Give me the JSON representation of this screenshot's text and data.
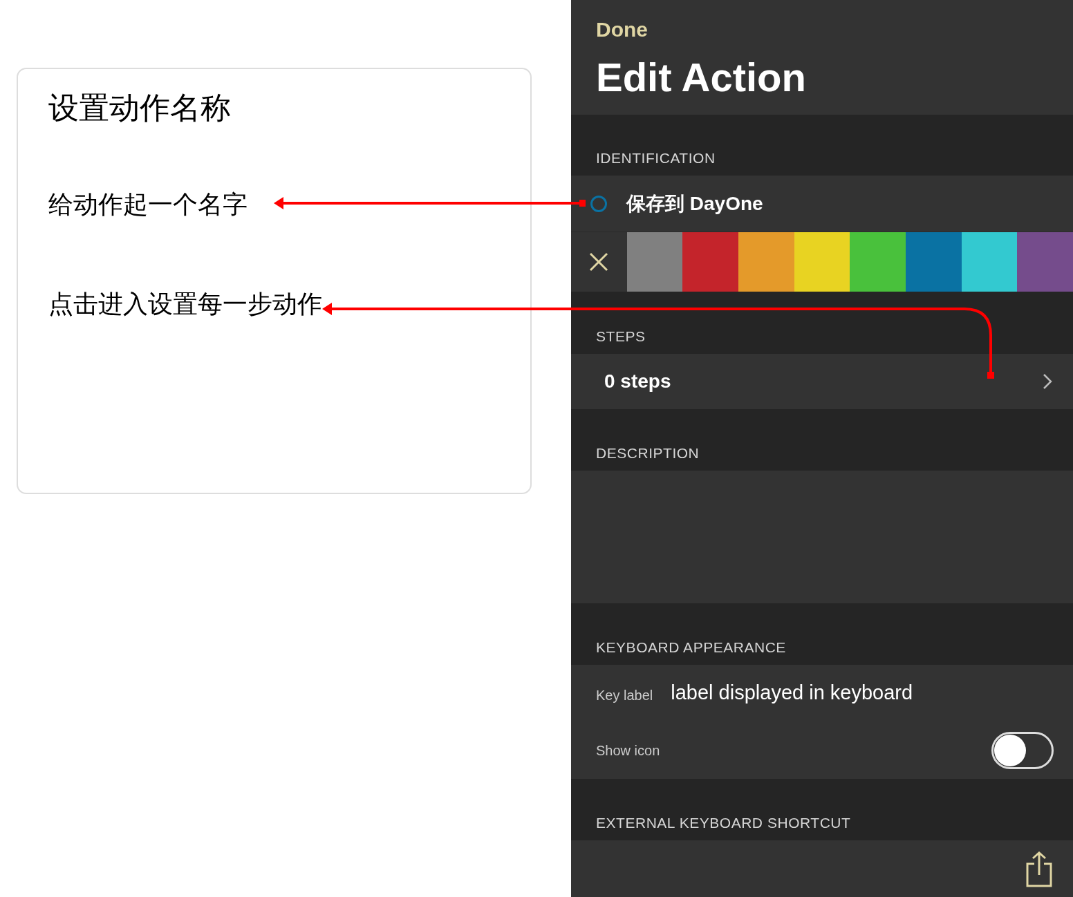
{
  "annotation_card": {
    "title": "设置动作名称",
    "notes": [
      "给动作起一个名字",
      "点击进入设置每一步动作"
    ]
  },
  "nav": {
    "done": "Done",
    "title": "Edit Action"
  },
  "identification": {
    "header": "IDENTIFICATION",
    "name": "保存到 DayOne",
    "swatches": [
      {
        "color": "#808080"
      },
      {
        "color": "#c4242b"
      },
      {
        "color": "#e49a2a"
      },
      {
        "color": "#e8d322"
      },
      {
        "color": "#49c13c"
      },
      {
        "color": "#0a72a3"
      },
      {
        "color": "#33c9d0"
      },
      {
        "color": "#754c8c"
      }
    ]
  },
  "steps": {
    "header": "STEPS",
    "value": "0 steps"
  },
  "description": {
    "header": "DESCRIPTION"
  },
  "keyboard_appearance": {
    "header": "KEYBOARD APPEARANCE",
    "key_label": {
      "label": "Key label",
      "placeholder": "label displayed in keyboard"
    },
    "show_icon": {
      "label": "Show icon",
      "on": false
    }
  },
  "external_shortcut": {
    "header": "EXTERNAL KEYBOARD SHORTCUT"
  }
}
